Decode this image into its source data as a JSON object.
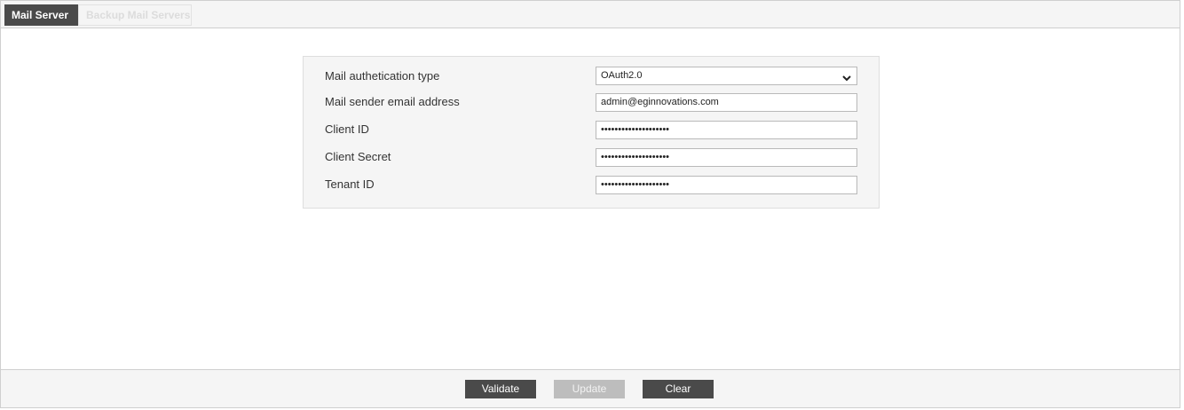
{
  "tabs": [
    {
      "label": "Mail Server",
      "active": true
    },
    {
      "label": "Backup Mail Servers",
      "active": false
    }
  ],
  "form": {
    "auth_type": {
      "label": "Mail authetication type",
      "value": "OAuth2.0"
    },
    "sender_email": {
      "label": "Mail sender email address",
      "value": "admin@eginnovations.com"
    },
    "client_id": {
      "label": "Client ID",
      "value": "••••••••••••••••••••"
    },
    "client_secret": {
      "label": "Client Secret",
      "value": "••••••••••••••••••••"
    },
    "tenant_id": {
      "label": "Tenant ID",
      "value": "••••••••••••••••••••"
    }
  },
  "buttons": {
    "validate": "Validate",
    "update": "Update",
    "clear": "Clear"
  },
  "icons": {
    "dropdown": "chevron-down-icon"
  },
  "colors": {
    "active_tab": "#4a4a4a",
    "button_dark": "#4a4a4a",
    "button_disabled": "#bdbdbd",
    "panel_bg": "#f5f5f5"
  }
}
